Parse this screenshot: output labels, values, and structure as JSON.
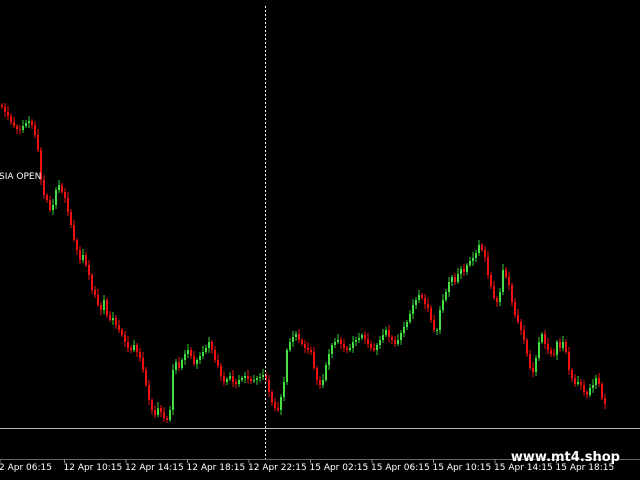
{
  "colors": {
    "background": "#000000",
    "bull": "#44dd44",
    "bear": "#ee1111",
    "wick": "#33cc33",
    "session_line": "#ffffff",
    "level_line": "#bbbbbb",
    "text": "#ffffff"
  },
  "annotation": {
    "label": "SIA OPEN"
  },
  "watermark": {
    "text": "www.mt4.shop"
  },
  "time_axis": {
    "labels": [
      "2 Apr 06:15",
      "12 Apr 10:15",
      "12 Apr 14:15",
      "12 Apr 18:15",
      "12 Apr 22:15",
      "15 Apr 02:15",
      "15 Apr 06:15",
      "15 Apr 10:15",
      "15 Apr 14:15",
      "15 Apr 18:15"
    ]
  },
  "chart_data": {
    "type": "candlestick",
    "grid": false,
    "y_range": [
      0,
      480
    ],
    "session_marker_index": 88,
    "horizontal_level": 52,
    "closes": [
      373,
      368,
      364,
      358,
      354,
      351,
      350,
      354,
      357,
      359,
      355,
      345,
      330,
      300,
      285,
      280,
      270,
      275,
      290,
      295,
      288,
      282,
      268,
      255,
      240,
      230,
      220,
      225,
      215,
      205,
      190,
      185,
      175,
      170,
      180,
      165,
      160,
      162,
      155,
      150,
      145,
      138,
      132,
      130,
      135,
      128,
      122,
      110,
      95,
      80,
      70,
      65,
      72,
      68,
      62,
      60,
      70,
      110,
      118,
      112,
      120,
      126,
      130,
      124,
      116,
      120,
      124,
      128,
      132,
      138,
      130,
      120,
      114,
      104,
      98,
      101,
      104,
      98,
      96,
      100,
      102,
      104,
      101,
      99,
      100,
      102,
      103,
      105,
      100,
      88,
      78,
      72,
      70,
      83,
      98,
      130,
      138,
      143,
      146,
      140,
      136,
      132,
      130,
      128,
      112,
      100,
      95,
      100,
      115,
      126,
      135,
      138,
      140,
      136,
      132,
      130,
      132,
      138,
      140,
      142,
      145,
      141,
      136,
      132,
      130,
      135,
      140,
      145,
      150,
      143,
      140,
      136,
      140,
      147,
      153,
      158,
      166,
      175,
      180,
      185,
      182,
      176,
      172,
      160,
      150,
      150,
      170,
      180,
      188,
      198,
      203,
      198,
      206,
      211,
      208,
      215,
      219,
      222,
      227,
      235,
      230,
      223,
      205,
      194,
      182,
      178,
      188,
      210,
      203,
      195,
      178,
      165,
      158,
      150,
      140,
      126,
      112,
      108,
      122,
      138,
      146,
      136,
      130,
      126,
      125,
      138,
      132,
      138,
      128,
      110,
      102,
      96,
      98,
      95,
      88,
      85,
      92,
      95,
      102,
      96,
      82,
      76
    ]
  }
}
